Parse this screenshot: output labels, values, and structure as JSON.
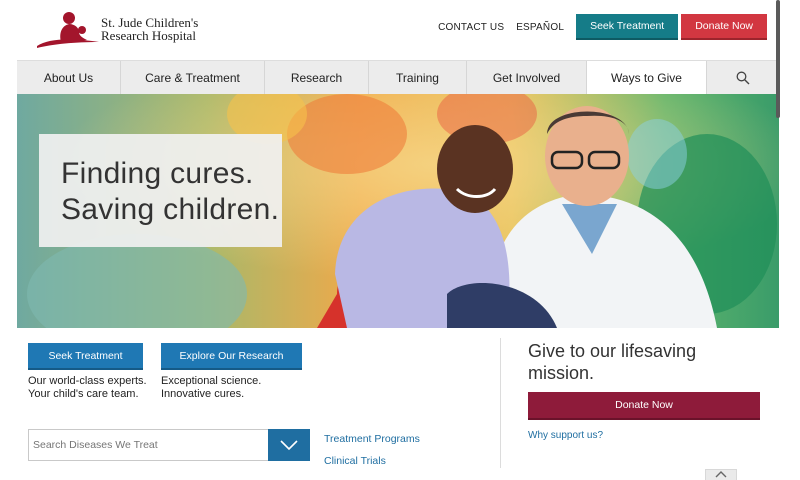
{
  "header": {
    "logo_line1": "St. Jude Children's",
    "logo_line2": "Research Hospital",
    "contact_label": "CONTACT US",
    "espanol_label": "ESPAÑOL",
    "seek_treatment_label": "Seek Treatment",
    "donate_now_label": "Donate Now"
  },
  "nav": {
    "items": [
      {
        "label": "About Us"
      },
      {
        "label": "Care & Treatment"
      },
      {
        "label": "Research"
      },
      {
        "label": "Training"
      },
      {
        "label": "Get Involved"
      },
      {
        "label": "Ways to Give"
      }
    ],
    "active": "Ways to Give",
    "search_icon": "search-icon"
  },
  "hero": {
    "line1": "Finding cures.",
    "line2": "Saving children."
  },
  "cta": {
    "seek_label": "Seek Treatment",
    "seek_text_line1": "Our world-class experts.",
    "seek_text_line2": "Your child's care team.",
    "research_label": "Explore Our Research",
    "research_text_line1": "Exceptional science.",
    "research_text_line2": "Innovative cures."
  },
  "search": {
    "placeholder": "Search Diseases We Treat",
    "dropdown_icon": "chevron-down-icon"
  },
  "side_links": {
    "treatment_programs": "Treatment Programs",
    "clinical_trials": "Clinical Trials"
  },
  "give": {
    "title_line1": "Give to our lifesaving",
    "title_line2": "mission.",
    "donate_label": "Donate Now",
    "why_label": "Why support us?"
  },
  "colors": {
    "teal": "#157c88",
    "red": "#d23741",
    "blue": "#1f78b4",
    "maroon": "#8e1b3a",
    "brand": "#a3152c"
  }
}
